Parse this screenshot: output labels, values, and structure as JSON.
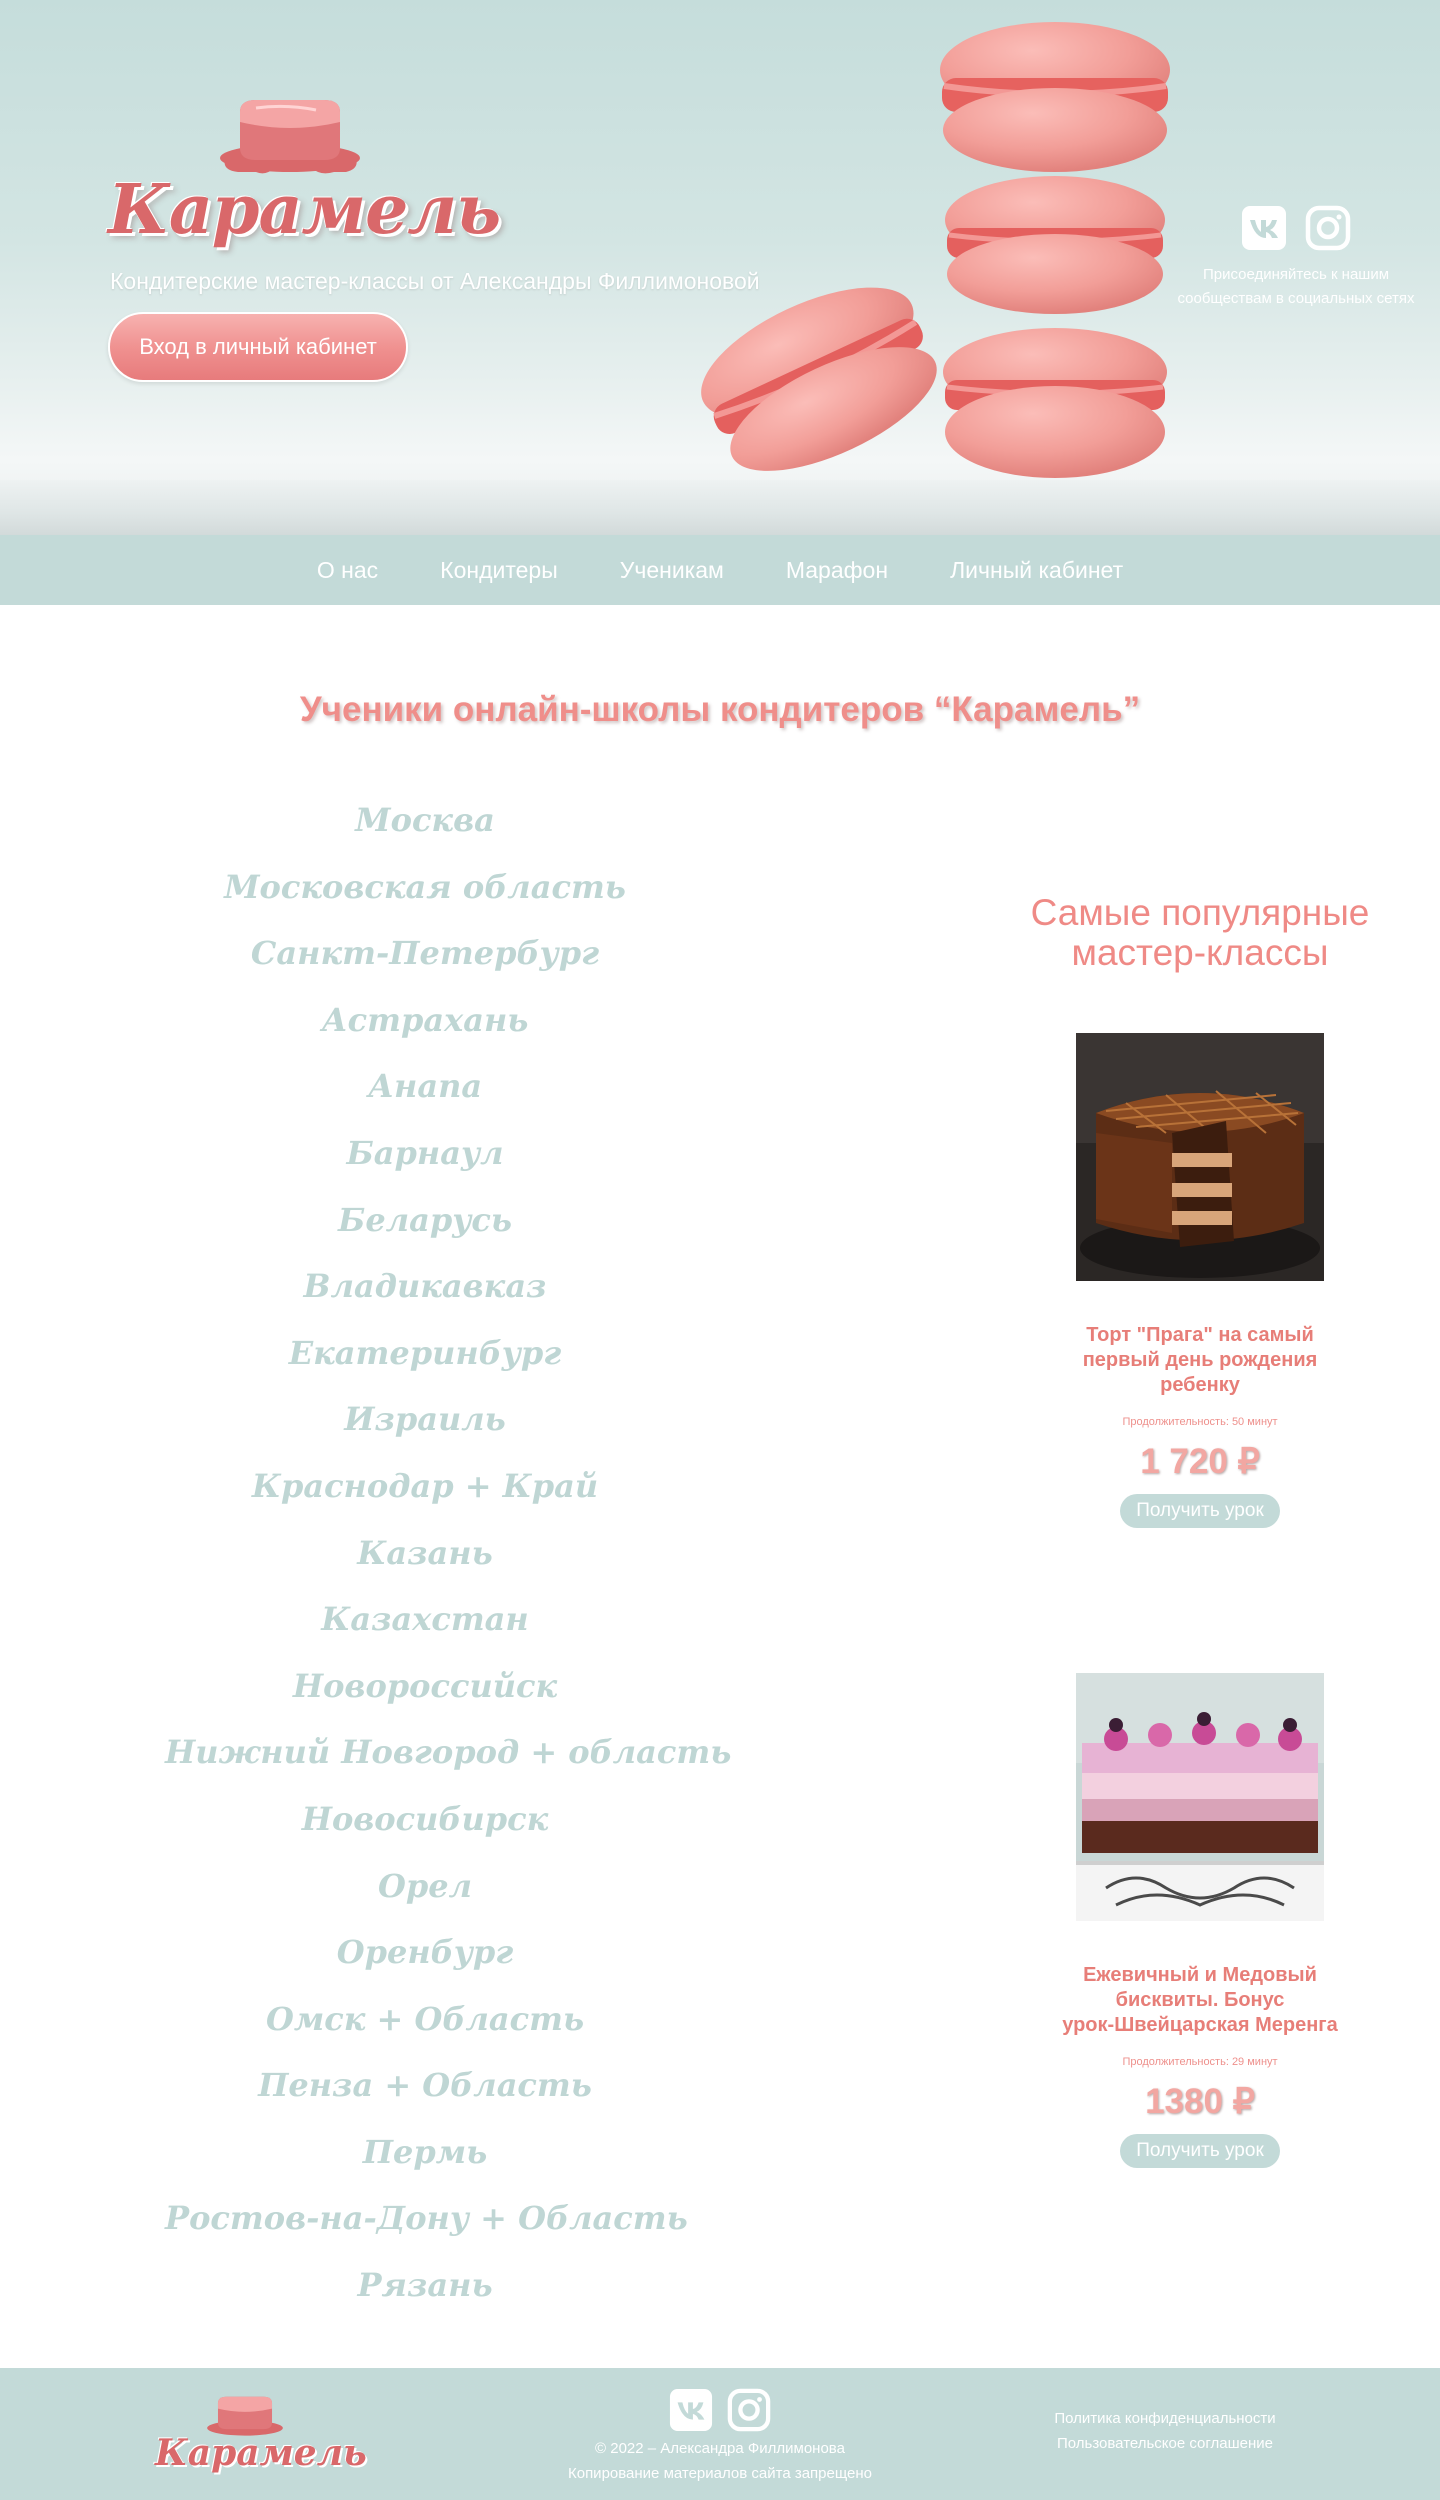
{
  "header": {
    "logo_text": "Карамель",
    "tagline": "Кондитерские мастер-классы от Александры Филлимоновой",
    "cabinet_button": "Вход в личный кабинет",
    "social_note_line1": "Присоединяйтесь к нашим",
    "social_note_line2": "сообществам в социальных сетях",
    "social_icons": [
      "vk-icon",
      "instagram-icon"
    ]
  },
  "nav": {
    "items": [
      "О нас",
      "Кондитеры",
      "Ученикам",
      "Марафон",
      "Личный кабинет"
    ]
  },
  "main": {
    "heading": "Ученики онлайн-школы кондитеров “Карамель”",
    "cities": [
      "Москва",
      "Московская область",
      "Санкт-Петербург",
      "Астрахань",
      "Анапа",
      "Барнаул",
      "Беларусь",
      "Владикавказ",
      "Екатеринбург",
      "Израиль",
      "Краснодар + Край",
      "Казань",
      "Казахстан",
      "Новороссийск",
      "Нижний Новгород + область",
      "Новосибирск",
      "Орел",
      "Оренбург",
      "Омск + Область",
      "Пенза + Область",
      "Пермь",
      "Ростов-на-Дону + Область",
      "Рязань"
    ]
  },
  "popular": {
    "title_line1": "Самые популярные",
    "title_line2": "мастер-классы",
    "courses": [
      {
        "title_line1": "Торт \"Прага\" на самый",
        "title_line2": "первый день рождения",
        "title_line3": "ребенку",
        "duration": "Продолжительность: 50 минут",
        "price": "1 720 ₽",
        "button": "Получить урок"
      },
      {
        "title_line1": "Ежевичный и Медовый",
        "title_line2": "бисквиты. Бонус",
        "title_line3": "урок-Швейцарская Меренга",
        "duration": "Продолжительность: 29 минут",
        "price": "1380 ₽",
        "button": "Получить урок"
      }
    ]
  },
  "footer": {
    "logo_text": "Карамель",
    "copyright": "© 2022 – Александра Филлимонова",
    "copy_notice": "Копирование материалов сайта запрещено",
    "privacy_link": "Политика конфиденциальности",
    "agreement_link": "Пользовательское соглашение"
  },
  "colors": {
    "accent_pink": "#ef8e8a",
    "mint": "#c3dad8",
    "city_text": "#bfd6d4"
  }
}
